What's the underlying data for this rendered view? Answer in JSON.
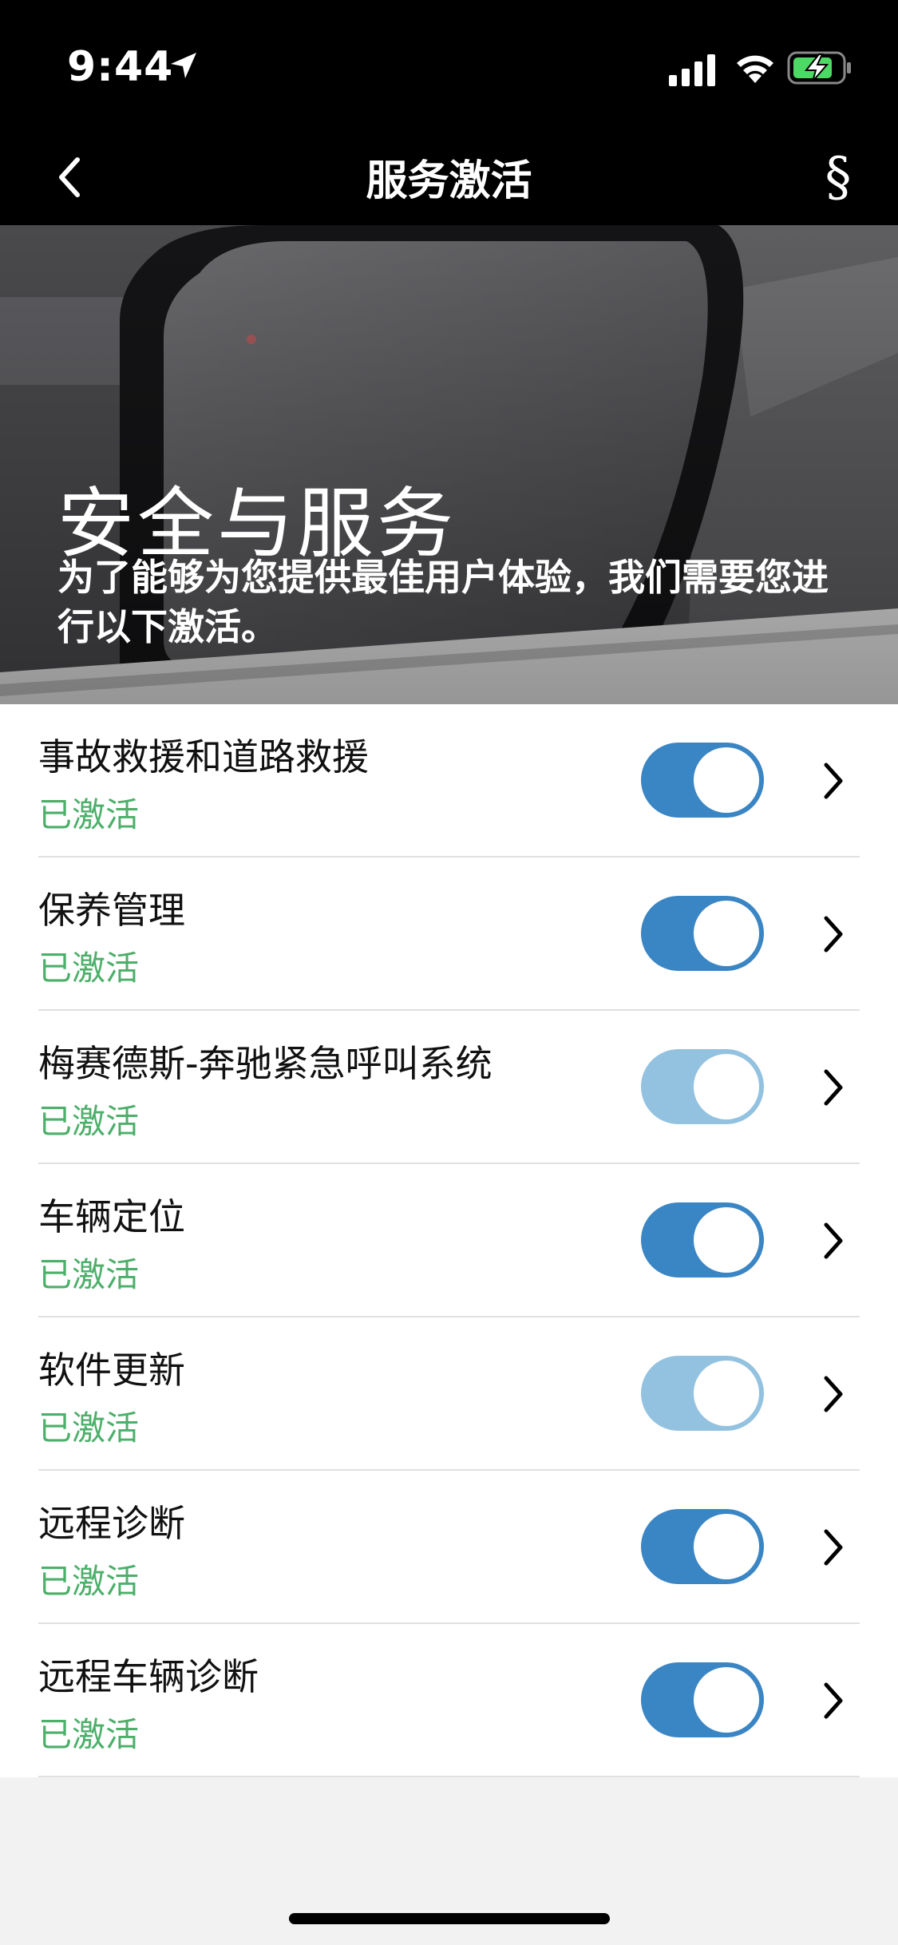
{
  "status_bar": {
    "time": "9:44",
    "icons": [
      "location-arrow-icon",
      "cellular-signal-icon",
      "wifi-icon",
      "battery-charging-icon"
    ]
  },
  "nav": {
    "title": "服务激活",
    "back_icon": "chevron-left-icon",
    "legal_label": "§"
  },
  "hero": {
    "title": "安全与服务",
    "subtitle": "为了能够为您提供最佳用户体验，我们需要您进行以下激活。",
    "image": "car-side-mirror"
  },
  "services": [
    {
      "title": "事故救援和道路救援",
      "status": "已激活",
      "enabled": true,
      "toggle_style": "active"
    },
    {
      "title": "保养管理",
      "status": "已激活",
      "enabled": true,
      "toggle_style": "active"
    },
    {
      "title": "梅赛德斯-奔驰紧急呼叫系统",
      "status": "已激活",
      "enabled": true,
      "toggle_style": "disabled"
    },
    {
      "title": "车辆定位",
      "status": "已激活",
      "enabled": true,
      "toggle_style": "active"
    },
    {
      "title": "软件更新",
      "status": "已激活",
      "enabled": true,
      "toggle_style": "disabled"
    },
    {
      "title": "远程诊断",
      "status": "已激活",
      "enabled": true,
      "toggle_style": "active"
    },
    {
      "title": "远程车辆诊断",
      "status": "已激活",
      "enabled": true,
      "toggle_style": "active"
    }
  ],
  "colors": {
    "toggle_on": "#3a85c4",
    "toggle_on_disabled": "#93c2e0",
    "status_green": "#4caf6a",
    "header_bg": "#000000"
  }
}
